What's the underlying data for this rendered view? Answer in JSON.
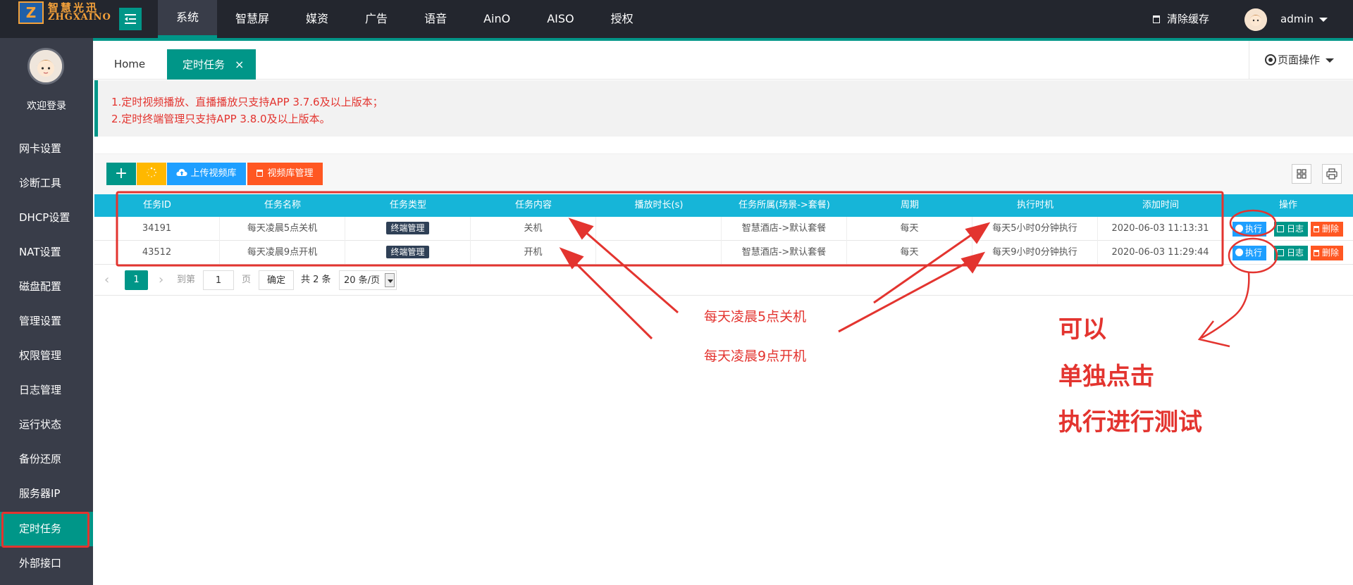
{
  "app": {
    "logo_mark": "Z",
    "logo_cn": "智慧光迅",
    "logo_en": "ZHGXAINO",
    "user": "admin",
    "clear_cache": "清除缓存",
    "welcome": "欢迎登录"
  },
  "top_nav": [
    {
      "label": "系统",
      "active": true
    },
    {
      "label": "智慧屏"
    },
    {
      "label": "媒资"
    },
    {
      "label": "广告"
    },
    {
      "label": "语音"
    },
    {
      "label": "AinO"
    },
    {
      "label": "AISO"
    },
    {
      "label": "授权"
    }
  ],
  "sidebar": [
    {
      "label": "网卡设置"
    },
    {
      "label": "诊断工具"
    },
    {
      "label": "DHCP设置"
    },
    {
      "label": "NAT设置"
    },
    {
      "label": "磁盘配置"
    },
    {
      "label": "管理设置"
    },
    {
      "label": "权限管理"
    },
    {
      "label": "日志管理"
    },
    {
      "label": "运行状态"
    },
    {
      "label": "备份还原"
    },
    {
      "label": "服务器IP"
    },
    {
      "label": "定时任务",
      "active": true
    },
    {
      "label": "外部接口"
    }
  ],
  "tabs": {
    "home": "Home",
    "active": "定时任务",
    "close": "×",
    "page_ops": "页面操作"
  },
  "notice": {
    "line1": "1.定时视频播放、直播播放只支持APP 3.7.6及以上版本；",
    "line2": "2.定时终端管理只支持APP 3.8.0及以上版本。"
  },
  "toolbar": {
    "add": "+",
    "upload": "上传视频库",
    "video_lib": "视频库管理"
  },
  "table": {
    "headers": [
      "任务ID",
      "任务名称",
      "任务类型",
      "任务内容",
      "播放时长(s)",
      "任务所属(场景->套餐)",
      "周期",
      "执行时机",
      "添加时间",
      "操作"
    ],
    "rows": [
      {
        "id": "34191",
        "name": "每天凌晨5点关机",
        "type": "终端管理",
        "content": "关机",
        "duration": "",
        "scope": "智慧酒店->默认套餐",
        "cycle": "每天",
        "timing": "每天5小时0分钟执行",
        "added": "2020-06-03 11:13:31"
      },
      {
        "id": "43512",
        "name": "每天凌晨9点开机",
        "type": "终端管理",
        "content": "开机",
        "duration": "",
        "scope": "智慧酒店->默认套餐",
        "cycle": "每天",
        "timing": "每天9小时0分钟执行",
        "added": "2020-06-03 11:29:44"
      }
    ],
    "ops": {
      "exec": "执行",
      "log": "日志",
      "del": "删除"
    }
  },
  "pager": {
    "prev": "‹",
    "current": "1",
    "next": "›",
    "goto": "到第",
    "page_input": "1",
    "page_unit": "页",
    "confirm": "确定",
    "total": "共 2 条",
    "page_size": "20 条/页"
  },
  "annotations": {
    "note1": "每天凌晨5点关机",
    "note2": "每天凌晨9点开机",
    "big1": "可以",
    "big2": "单独点击",
    "big3": "执行进行测试",
    "color": "#e3342f"
  },
  "colors": {
    "topbar": "#23262e",
    "sidebar": "#393d49",
    "primary": "#009688",
    "table_head": "#16b5d8",
    "warm": "#ffb800",
    "blue": "#1e9fff",
    "danger": "#ff5722"
  }
}
